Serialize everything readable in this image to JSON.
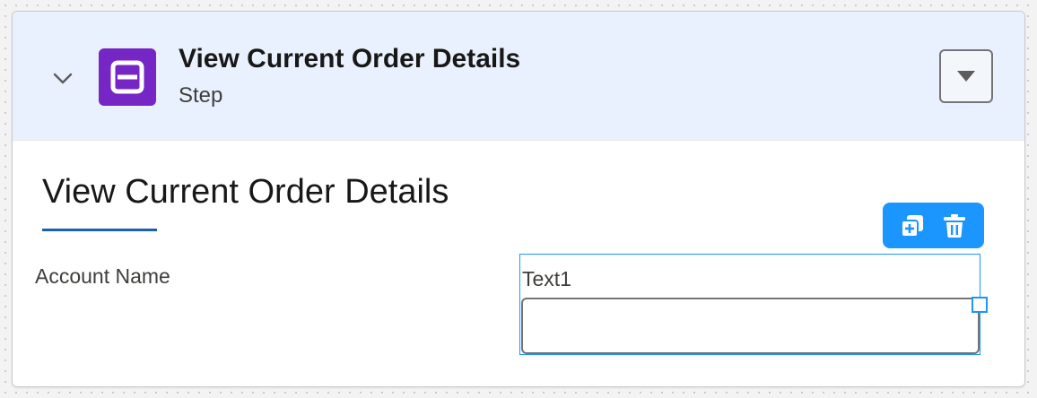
{
  "step": {
    "title": "View Current Order Details",
    "subtitle": "Step",
    "icon": "screen-step-icon",
    "icon_color": "#7526c4"
  },
  "header": {
    "expand_icon": "chevron-down-icon",
    "menu_icon": "caret-down-icon"
  },
  "section": {
    "title": "View Current Order Details"
  },
  "fields": {
    "account_name_label": "Account Name",
    "text1_label": "Text1",
    "text1_value": ""
  },
  "toolbar": {
    "duplicate_icon": "duplicate-icon",
    "delete_icon": "trash-icon",
    "color": "#1b96ff"
  },
  "colors": {
    "header_bg": "#eaf1fe",
    "selection": "#1b96ff",
    "underline": "#1b5fad"
  }
}
